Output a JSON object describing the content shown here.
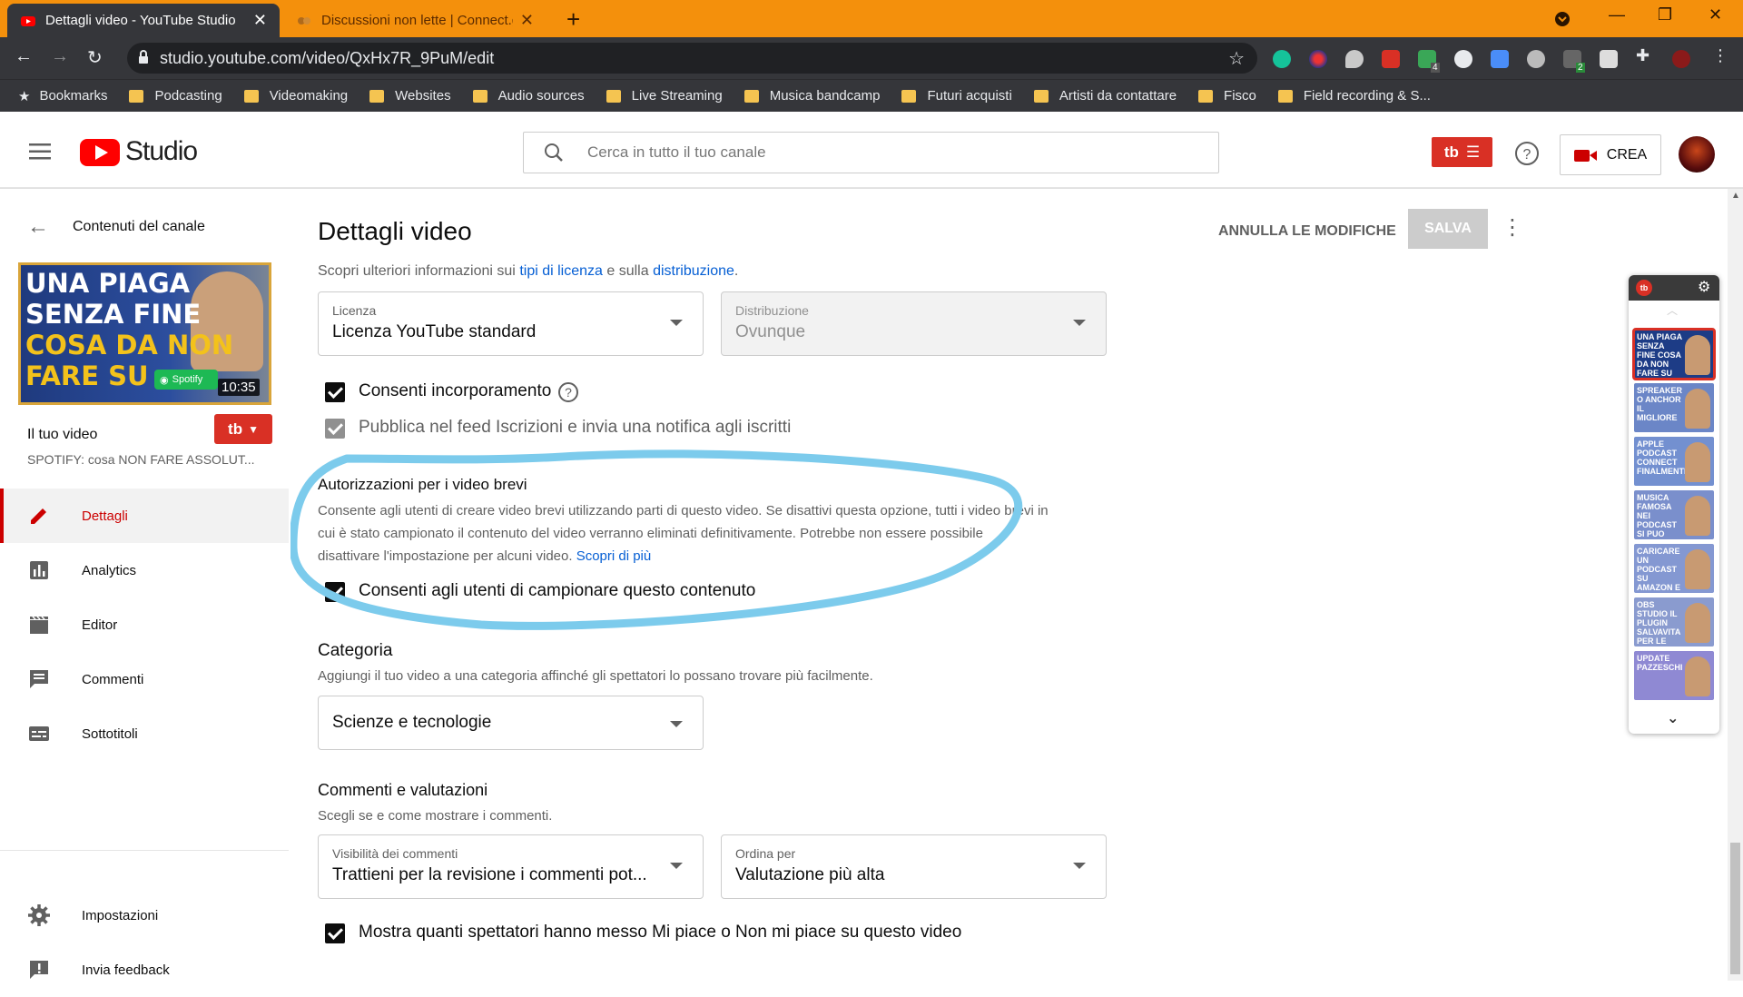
{
  "browser": {
    "tabs": [
      {
        "title": "Dettagli video - YouTube Studio",
        "active": true
      },
      {
        "title": "Discussioni non lette | Connect.g",
        "active": false
      }
    ],
    "url": "studio.youtube.com/video/QxHx7R_9PuM/edit",
    "extension_badges": {
      "badge1": "4",
      "badge2": "2"
    },
    "bookmarks": [
      "Bookmarks",
      "Podcasting",
      "Videomaking",
      "Websites",
      "Audio sources",
      "Live Streaming",
      "Musica bandcamp",
      "Futuri acquisti",
      "Artisti da contattare",
      "Fisco",
      "Field recording & S..."
    ]
  },
  "header": {
    "logo_text": "Studio",
    "search_placeholder": "Cerca in tutto il tuo canale",
    "create_label": "CREA",
    "tb_label": "tb"
  },
  "sidebar": {
    "back_label": "Contenuti del canale",
    "thumbnail": {
      "line1": "UNA PIAGA",
      "line2": "SENZA FINE",
      "line3": "COSA DA NON",
      "line4": "FARE SU",
      "spotify_label": "Spotify",
      "duration": "10:35"
    },
    "your_video_label": "Il tuo video",
    "video_title": "SPOTIFY: cosa NON FARE ASSOLUT...",
    "nav": [
      {
        "label": "Dettagli",
        "icon": "pencil-icon",
        "active": true
      },
      {
        "label": "Analytics",
        "icon": "analytics-icon",
        "active": false
      },
      {
        "label": "Editor",
        "icon": "film-icon",
        "active": false
      },
      {
        "label": "Commenti",
        "icon": "comments-icon",
        "active": false
      },
      {
        "label": "Sottotitoli",
        "icon": "subtitles-icon",
        "active": false
      }
    ],
    "bottom": [
      {
        "label": "Impostazioni",
        "icon": "gear-icon"
      },
      {
        "label": "Invia feedback",
        "icon": "feedback-icon"
      }
    ]
  },
  "main": {
    "page_title": "Dettagli video",
    "undo_label": "ANNULLA LE MODIFICHE",
    "save_label": "SALVA",
    "license_info": {
      "prefix": "Scopri ulteriori informazioni sui ",
      "link1": "tipi di licenza",
      "middle": " e sulla ",
      "link2": "distribuzione",
      "suffix": "."
    },
    "license": {
      "caption": "Licenza",
      "value": "Licenza YouTube standard"
    },
    "distribution": {
      "caption": "Distribuzione",
      "value": "Ovunque"
    },
    "allow_embedding": "Consenti incorporamento",
    "publish_feed": "Pubblica nel feed Iscrizioni e invia una notifica agli iscritti",
    "shorts": {
      "title": "Autorizzazioni per i video brevi",
      "desc_line1": "Consente agli utenti di creare video brevi utilizzando parti di questo video. Se disattivi questa opzione, tutti i video brevi in",
      "desc_line2": "cui è stato campionato il contenuto del video verranno eliminati definitivamente. Potrebbe non essere possibile",
      "desc_line3": "disattivare l'impostazione per alcuni video. ",
      "learn_more": "Scopri di più",
      "checkbox": "Consenti agli utenti di campionare questo contenuto"
    },
    "category": {
      "title": "Categoria",
      "desc": "Aggiungi il tuo video a una categoria affinché gli spettatori lo possano trovare più facilmente.",
      "value": "Scienze e tecnologie"
    },
    "comments": {
      "title": "Commenti e valutazioni",
      "desc": "Scegli se e come mostrare i commenti.",
      "visibility_caption": "Visibilità dei commenti",
      "visibility_value": "Trattieni per la revisione i commenti pot...",
      "sort_caption": "Ordina per",
      "sort_value": "Valutazione più alta"
    },
    "show_likes": "Mostra quanti spettatori hanno messo Mi piace o Non mi piace su questo video"
  },
  "widget": {
    "thumbs": [
      {
        "text": "UNA PIAGA SENZA FINE COSA DA NON FARE SU",
        "color": "#1d3c86",
        "selected": true
      },
      {
        "text": "SPREAKER O ANCHOR IL MIGLIORE",
        "color": "#6b86c7",
        "selected": false
      },
      {
        "text": "APPLE PODCAST CONNECT FINALMENTE",
        "color": "#7390d0",
        "selected": false
      },
      {
        "text": "MUSICA FAMOSA NEI PODCAST SI PUO",
        "color": "#7a8fcc",
        "selected": false
      },
      {
        "text": "CARICARE UN PODCAST SU AMAZON E AUDIBLE",
        "color": "#8498d2",
        "selected": false
      },
      {
        "text": "OBS STUDIO IL PLUGIN SALVAVITA PER LE TUE DAW",
        "color": "#8a9bcf",
        "selected": false
      },
      {
        "text": "UPDATE PAZZESCHI",
        "color": "#8f89d3",
        "selected": false
      }
    ]
  },
  "colors": {
    "accent": "#cc0000",
    "link": "#065fd4",
    "annotation": "#7ccbec",
    "tab_strip": "#f4900c"
  }
}
